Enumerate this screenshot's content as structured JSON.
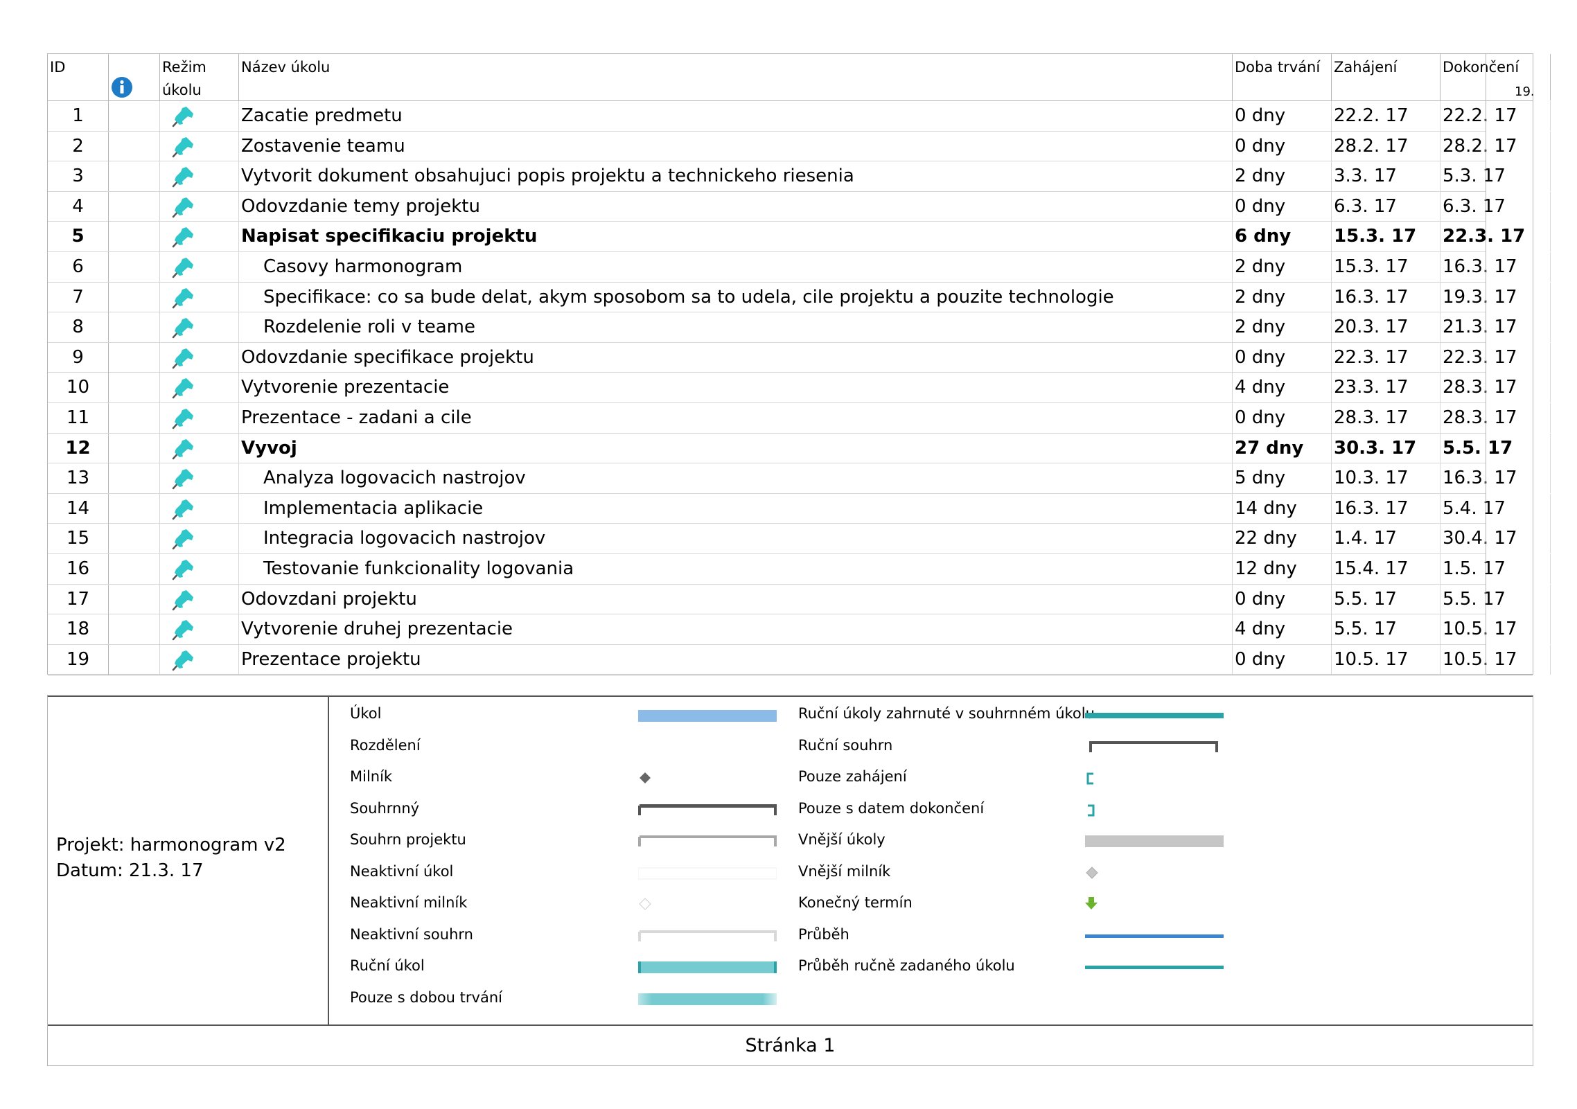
{
  "header": {
    "id": "ID",
    "mode": "Režim úkolu",
    "name": "Název úkolu",
    "duration": "Doba trvání",
    "start": "Zahájení",
    "finish": "Dokončení",
    "timescale": "19."
  },
  "tasks": [
    {
      "id": "1",
      "name": "Zacatie predmetu",
      "duration": "0 dny",
      "start": "22.2. 17",
      "finish": "22.2. 17"
    },
    {
      "id": "2",
      "name": "Zostavenie teamu",
      "duration": "0 dny",
      "start": "28.2. 17",
      "finish": "28.2. 17"
    },
    {
      "id": "3",
      "name": "Vytvorit dokument obsahujuci popis projektu a technickeho riesenia",
      "duration": "2 dny",
      "start": "3.3. 17",
      "finish": "5.3. 17"
    },
    {
      "id": "4",
      "name": "Odovzdanie temy projektu",
      "duration": "0 dny",
      "start": "6.3. 17",
      "finish": "6.3. 17"
    },
    {
      "id": "5",
      "name": "Napisat specifikaciu projektu",
      "duration": "6 dny",
      "start": "15.3. 17",
      "finish": "22.3. 17",
      "summary": true
    },
    {
      "id": "6",
      "name": "Casovy harmonogram",
      "duration": "2 dny",
      "start": "15.3. 17",
      "finish": "16.3. 17",
      "indent": true
    },
    {
      "id": "7",
      "name": "Specifikace: co sa bude delat, akym sposobom sa to udela, cile projektu a pouzite technologie",
      "duration": "2 dny",
      "start": "16.3. 17",
      "finish": "19.3. 17",
      "indent": true
    },
    {
      "id": "8",
      "name": "Rozdelenie roli v teame",
      "duration": "2 dny",
      "start": "20.3. 17",
      "finish": "21.3. 17",
      "indent": true
    },
    {
      "id": "9",
      "name": "Odovzdanie specifikace projektu",
      "duration": "0 dny",
      "start": "22.3. 17",
      "finish": "22.3. 17"
    },
    {
      "id": "10",
      "name": "Vytvorenie prezentacie",
      "duration": "4 dny",
      "start": "23.3. 17",
      "finish": "28.3. 17"
    },
    {
      "id": "11",
      "name": "Prezentace - zadani a cile",
      "duration": "0 dny",
      "start": "28.3. 17",
      "finish": "28.3. 17"
    },
    {
      "id": "12",
      "name": "Vyvoj",
      "duration": "27 dny",
      "start": "30.3. 17",
      "finish": "5.5. 17",
      "summary": true
    },
    {
      "id": "13",
      "name": "Analyza logovacich nastrojov",
      "duration": "5 dny",
      "start": "10.3. 17",
      "finish": "16.3. 17",
      "indent": true
    },
    {
      "id": "14",
      "name": "Implementacia aplikacie",
      "duration": "14 dny",
      "start": "16.3. 17",
      "finish": "5.4. 17",
      "indent": true
    },
    {
      "id": "15",
      "name": "Integracia logovacich nastrojov",
      "duration": "22 dny",
      "start": "1.4. 17",
      "finish": "30.4. 17",
      "indent": true
    },
    {
      "id": "16",
      "name": "Testovanie funkcionality logovania",
      "duration": "12 dny",
      "start": "15.4. 17",
      "finish": "1.5. 17",
      "indent": true
    },
    {
      "id": "17",
      "name": "Odovzdani projektu",
      "duration": "0 dny",
      "start": "5.5. 17",
      "finish": "5.5. 17"
    },
    {
      "id": "18",
      "name": "Vytvorenie druhej prezentacie",
      "duration": "4 dny",
      "start": "5.5. 17",
      "finish": "10.5. 17"
    },
    {
      "id": "19",
      "name": "Prezentace projektu",
      "duration": "0 dny",
      "start": "10.5. 17",
      "finish": "10.5. 17"
    }
  ],
  "project": {
    "line1": "Projekt: harmonogram v2",
    "line2": "Datum: 21.3. 17"
  },
  "legend_left": [
    {
      "label": "Úkol",
      "symbol": "task-bar"
    },
    {
      "label": "Rozdělení",
      "symbol": "split"
    },
    {
      "label": "Milník",
      "symbol": "milestone"
    },
    {
      "label": "Souhrnný",
      "symbol": "summary"
    },
    {
      "label": "Souhrn projektu",
      "symbol": "project-summary"
    },
    {
      "label": "Neaktivní úkol",
      "symbol": "inactive-task"
    },
    {
      "label": "Neaktivní milník",
      "symbol": "inactive-milestone"
    },
    {
      "label": "Neaktivní souhrn",
      "symbol": "inactive-summary"
    },
    {
      "label": "Ruční úkol",
      "symbol": "manual-task"
    },
    {
      "label": "Pouze s dobou trvání",
      "symbol": "duration-only"
    }
  ],
  "legend_right": [
    {
      "label": "Ruční úkoly zahrnuté v souhrnném úkolu",
      "symbol": "manual-summary-rollup"
    },
    {
      "label": "Ruční souhrn",
      "symbol": "manual-summary"
    },
    {
      "label": "Pouze zahájení",
      "symbol": "start-only"
    },
    {
      "label": "Pouze s datem dokončení",
      "symbol": "finish-only"
    },
    {
      "label": "Vnější úkoly",
      "symbol": "external-tasks"
    },
    {
      "label": "Vnější milník",
      "symbol": "external-milestone"
    },
    {
      "label": "Konečný termín",
      "symbol": "deadline"
    },
    {
      "label": "Průběh",
      "symbol": "progress"
    },
    {
      "label": "Průběh ručně zadaného úkolu",
      "symbol": "manual-progress"
    }
  ],
  "footer": "Stránka 1",
  "colors": {
    "task": "#8dbbe8",
    "manual": "#75cbd0",
    "manual_rollup": "#2aa3a8",
    "summary": "#555555",
    "project_summary": "#a8a8a8",
    "external": "#c6c6c6",
    "deadline": "#6ab42d",
    "progress": "#3a86d1",
    "pin": "#2fc7c9",
    "info": "#1e7cc7"
  }
}
